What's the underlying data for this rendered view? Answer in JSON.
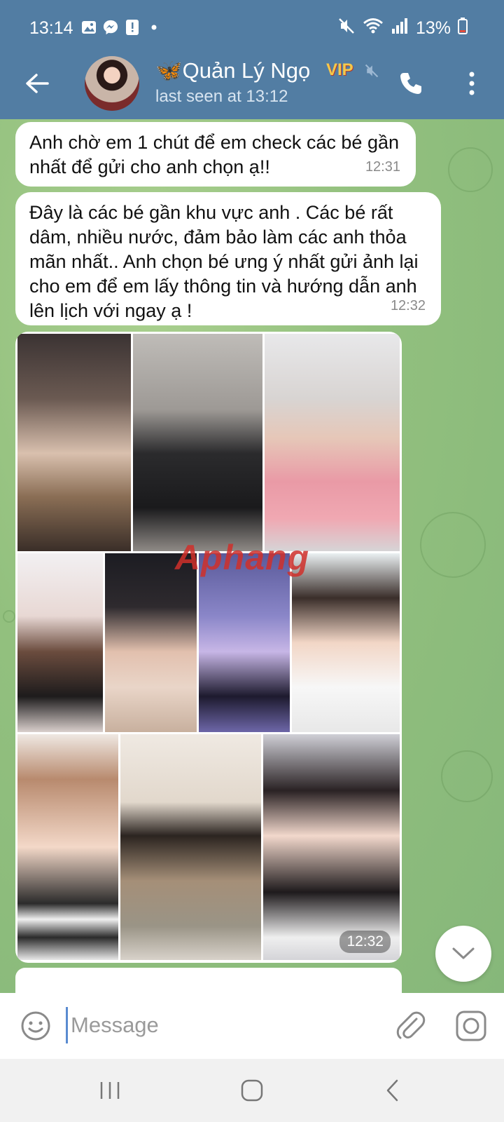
{
  "status_bar": {
    "time": "13:14",
    "battery": "13%",
    "left_icons": [
      "image-icon",
      "messenger-icon",
      "alert-icon",
      "dot-icon"
    ],
    "right_icons": [
      "mute-icon",
      "wifi-icon",
      "signal-icon",
      "battery-icon"
    ]
  },
  "header": {
    "title": "🦋Quản Lý Ngọ",
    "badge": "VIP",
    "subtitle": "last seen at 13:12"
  },
  "messages": [
    {
      "text": "Anh chờ em 1 chút để em check các bé gần nhất để gửi cho anh chọn ạ!!",
      "time": "12:31"
    },
    {
      "text": "Đây là các bé gần khu vực anh . Các bé rất dâm, nhiều nước, đảm bảo làm các anh thỏa mãn nhất..  Anh chọn bé ưng ý nhất gửi ảnh lại cho em để em lấy thông tin và hướng dẫn anh lên lịch với ngay ạ !",
      "time": "12:32"
    }
  ],
  "album": {
    "time": "12:32",
    "watermark": "Aphang",
    "photo_count": 10
  },
  "input": {
    "placeholder": "Message"
  },
  "colors": {
    "header": "#527da3",
    "chat_bg": "#8fbf7a",
    "bubble": "#ffffff",
    "accent": "#5a8bd0"
  }
}
